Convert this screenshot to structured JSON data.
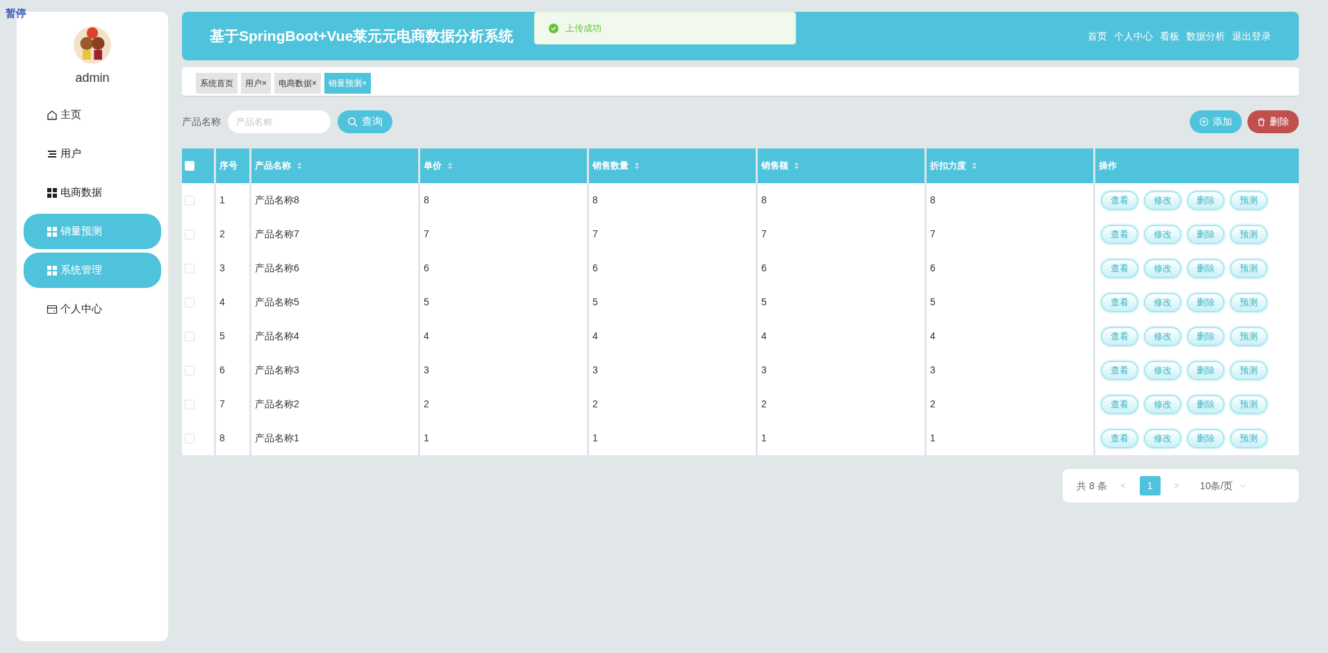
{
  "overlay_label": "暂停",
  "sidebar": {
    "username": "admin",
    "items": [
      {
        "label": "主页",
        "kind": "home",
        "highlighted": false
      },
      {
        "label": "用户",
        "kind": "list",
        "highlighted": false
      },
      {
        "label": "电商数据",
        "kind": "grid",
        "highlighted": false
      },
      {
        "label": "销量预测",
        "kind": "grid",
        "highlighted": true
      },
      {
        "label": "系统管理",
        "kind": "grid",
        "highlighted": true
      },
      {
        "label": "个人中心",
        "kind": "card",
        "highlighted": false
      }
    ]
  },
  "header": {
    "title": "基于SpringBoot+Vue莱元元电商数据分析系统",
    "nav": [
      "首页",
      "个人中心",
      "看板",
      "数据分析",
      "退出登录"
    ]
  },
  "toast": {
    "message": "上传成功"
  },
  "tabs": [
    {
      "label": "系统首页",
      "selected": false
    },
    {
      "label": "用户",
      "close": "×",
      "selected": false
    },
    {
      "label": "电商数据",
      "close": "×",
      "selected": false
    },
    {
      "label": "销量预测",
      "close": "×",
      "selected": true
    }
  ],
  "search": {
    "label": "产品名称",
    "placeholder": "产品名称",
    "button": "查询"
  },
  "toolbar": [
    {
      "label": "添加",
      "kind": "add"
    },
    {
      "label": "删除",
      "kind": "delete"
    }
  ],
  "table": {
    "header_checked": false,
    "columns": [
      {
        "label": "序号",
        "sortable": false
      },
      {
        "label": "产品名称",
        "sortable": true
      },
      {
        "label": "单价",
        "sortable": true
      },
      {
        "label": "销售数量",
        "sortable": true
      },
      {
        "label": "销售额",
        "sortable": true
      },
      {
        "label": "折扣力度",
        "sortable": true
      },
      {
        "label": "操作",
        "sortable": false
      }
    ],
    "rows": [
      {
        "checked": false,
        "cells": [
          "1",
          "产品名称8",
          "8",
          "8",
          "8",
          "8"
        ],
        "actions": [
          "查看",
          "修改",
          "删除",
          "预测"
        ]
      },
      {
        "checked": false,
        "cells": [
          "2",
          "产品名称7",
          "7",
          "7",
          "7",
          "7"
        ],
        "actions": [
          "查看",
          "修改",
          "删除",
          "预测"
        ]
      },
      {
        "checked": false,
        "cells": [
          "3",
          "产品名称6",
          "6",
          "6",
          "6",
          "6"
        ],
        "actions": [
          "查看",
          "修改",
          "删除",
          "预测"
        ]
      },
      {
        "checked": false,
        "cells": [
          "4",
          "产品名称5",
          "5",
          "5",
          "5",
          "5"
        ],
        "actions": [
          "查看",
          "修改",
          "删除",
          "预测"
        ]
      },
      {
        "checked": false,
        "cells": [
          "5",
          "产品名称4",
          "4",
          "4",
          "4",
          "4"
        ],
        "actions": [
          "查看",
          "修改",
          "删除",
          "预测"
        ]
      },
      {
        "checked": false,
        "cells": [
          "6",
          "产品名称3",
          "3",
          "3",
          "3",
          "3"
        ],
        "actions": [
          "查看",
          "修改",
          "删除",
          "预测"
        ]
      },
      {
        "checked": false,
        "cells": [
          "7",
          "产品名称2",
          "2",
          "2",
          "2",
          "2"
        ],
        "actions": [
          "查看",
          "修改",
          "删除",
          "预测"
        ]
      },
      {
        "checked": false,
        "cells": [
          "8",
          "产品名称1",
          "1",
          "1",
          "1",
          "1"
        ],
        "actions": [
          "查看",
          "修改",
          "删除",
          "预测"
        ]
      }
    ]
  },
  "pagination": {
    "total": "共 8 条",
    "prev": "<",
    "pages": [
      {
        "label": "1",
        "selected": true
      }
    ],
    "next": ">",
    "page_size": "10条/页"
  }
}
